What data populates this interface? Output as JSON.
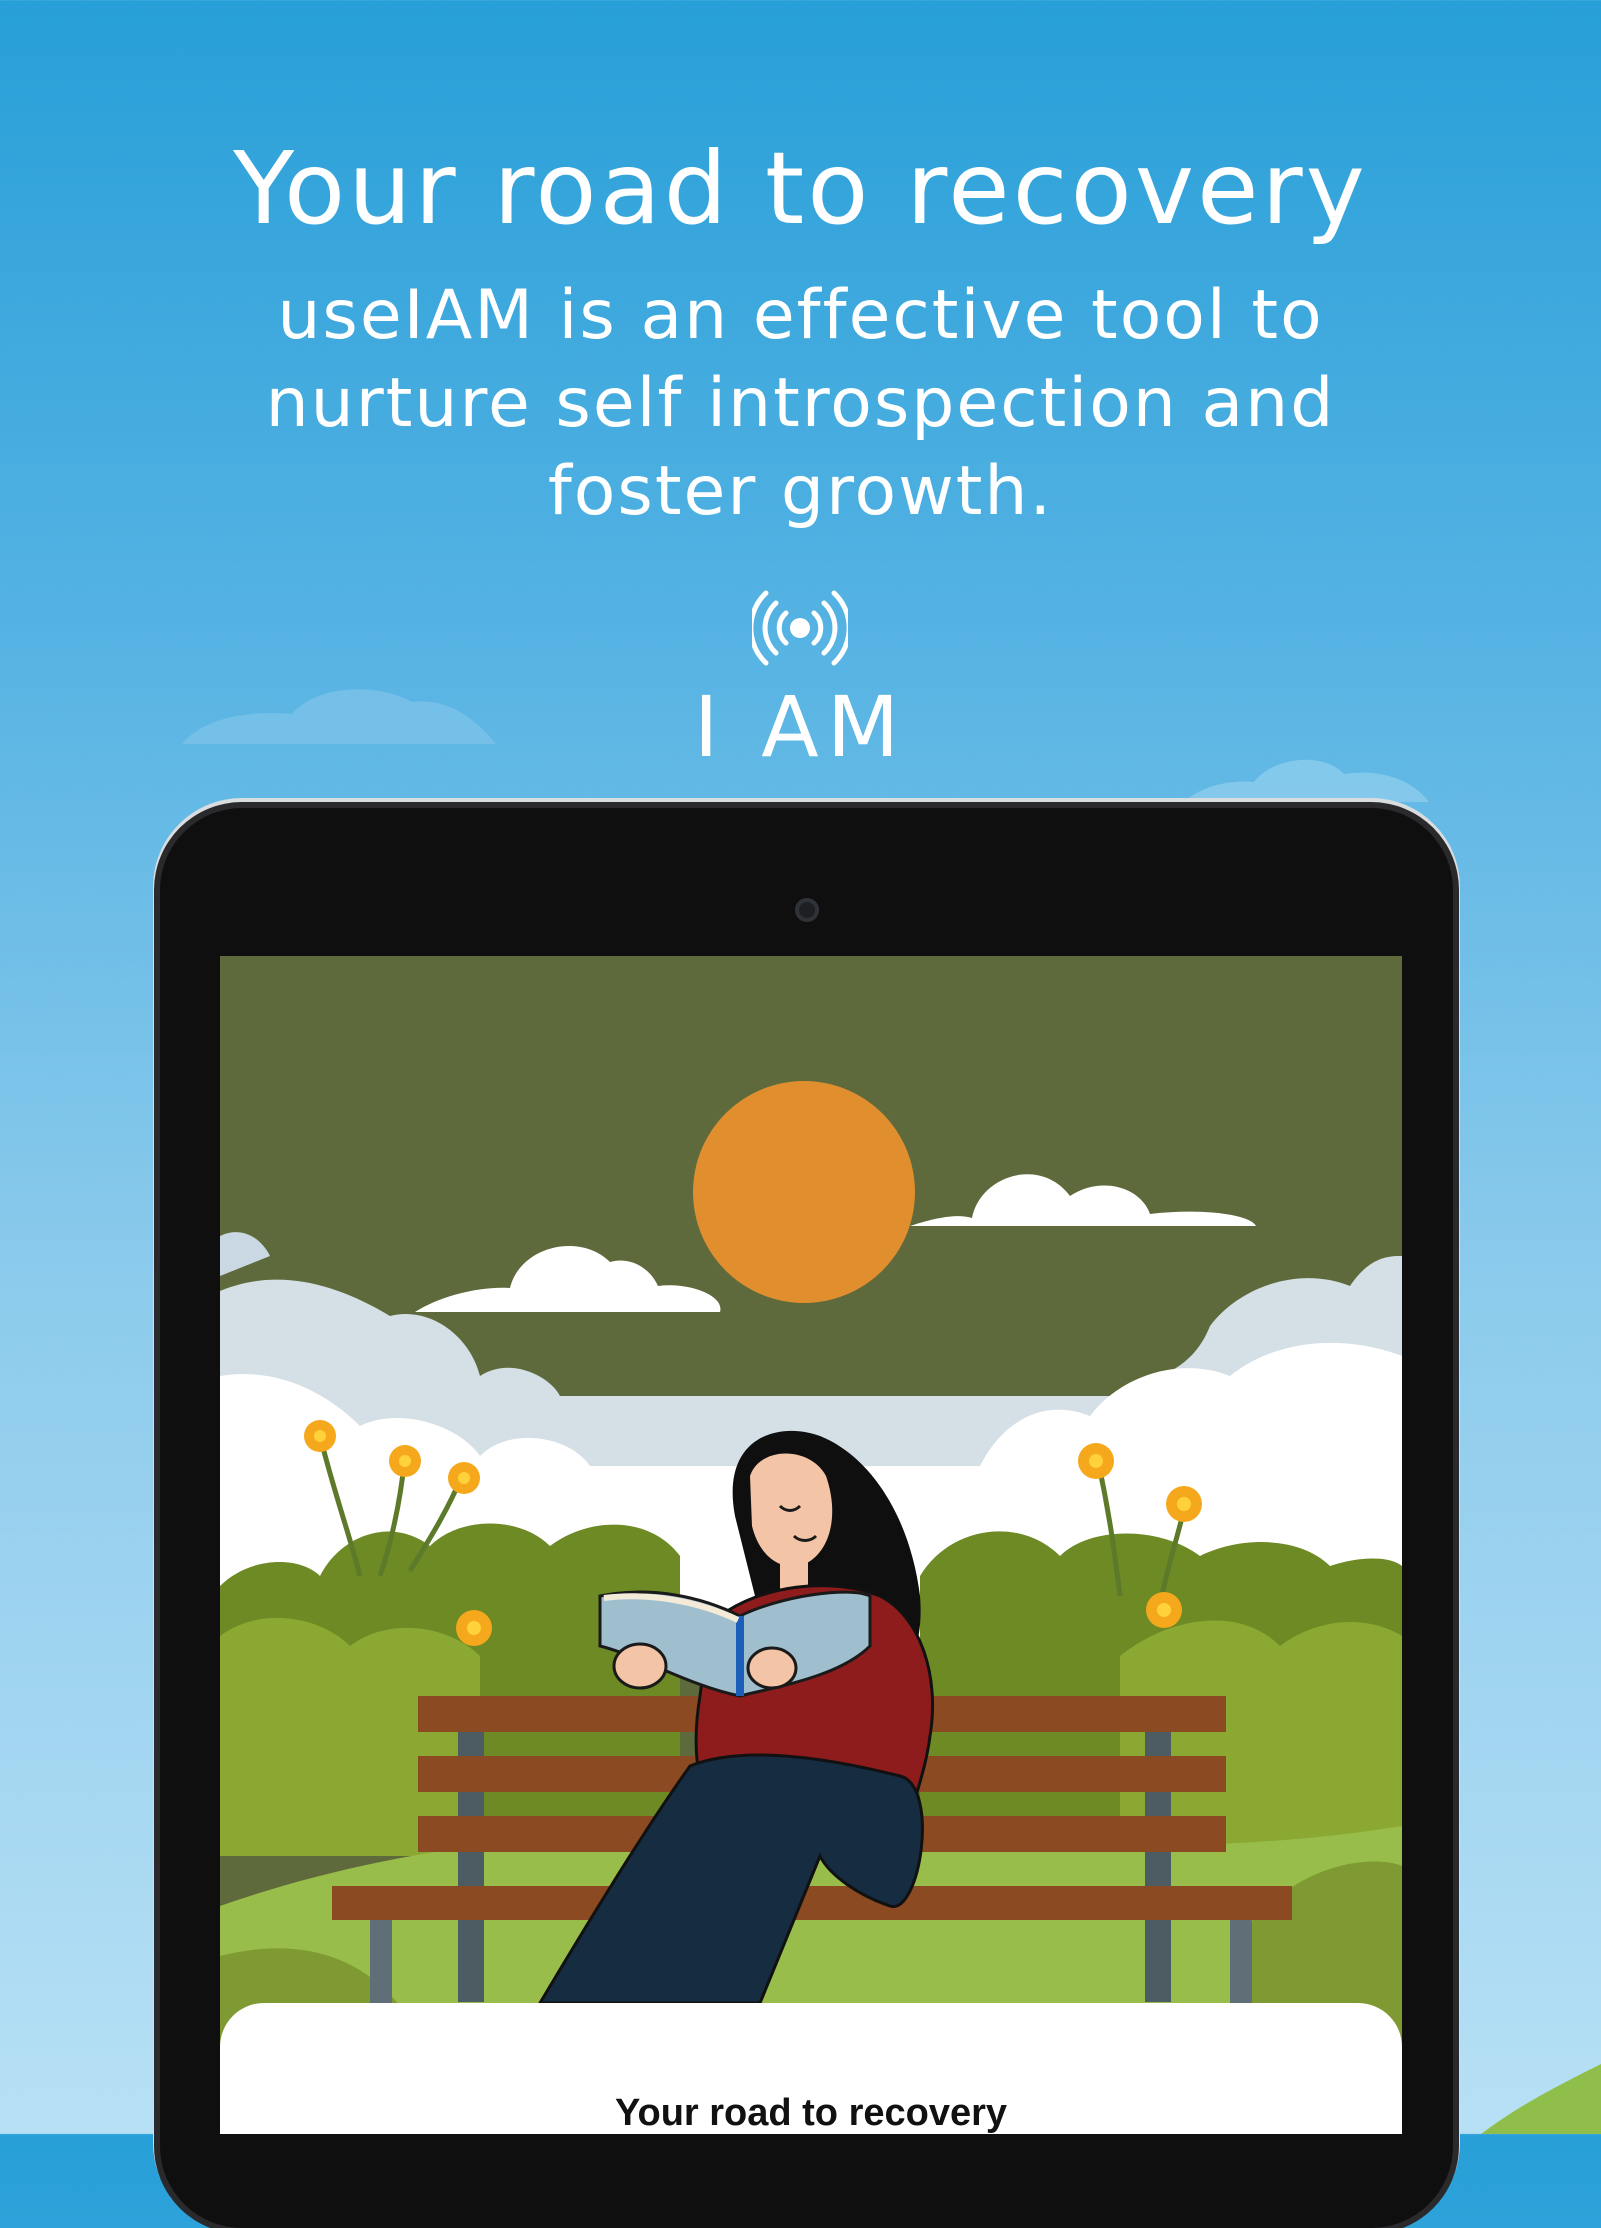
{
  "header": {
    "headline": "Your road to recovery",
    "subline": "useIAM is an effective tool to nurture self introspection and foster growth."
  },
  "brand": {
    "icon": "broadcast-icon",
    "name": "I AM"
  },
  "device": {
    "type": "tablet",
    "screen": {
      "illustration": "woman-reading-on-park-bench",
      "sheet_title": "Your road to recovery"
    }
  },
  "colors": {
    "sky_top": "#279fd8",
    "sky_bottom": "#b7e0f5",
    "illustration_sky": "#5e6a3b",
    "sun": "#e08e2e",
    "bench": "#8b4a21",
    "sweater": "#8f1c1d",
    "jeans": "#152c41"
  }
}
